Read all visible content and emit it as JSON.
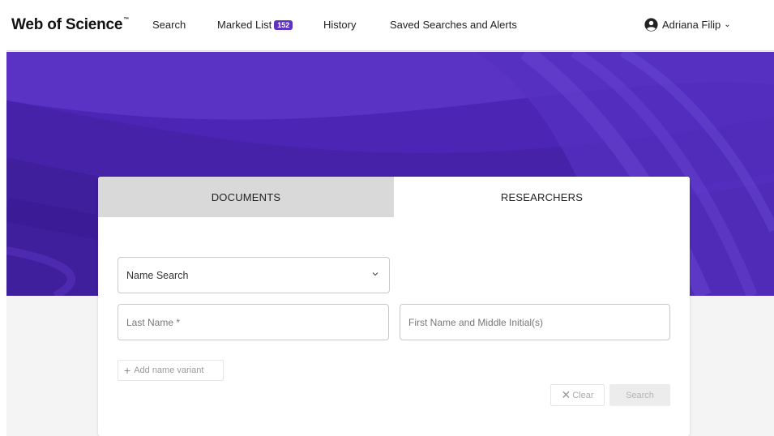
{
  "brand": {
    "name": "Web of Science",
    "mark": "™"
  },
  "nav": {
    "search": "Search",
    "marked_list": "Marked List",
    "marked_count": "152",
    "history": "History",
    "saved": "Saved Searches and Alerts"
  },
  "user": {
    "name": "Adriana Filip",
    "icon": "user-circle-icon"
  },
  "tabs": {
    "documents": "DOCUMENTS",
    "researchers": "RESEARCHERS"
  },
  "form": {
    "search_type": "Name Search",
    "last_name_placeholder": "Last Name *",
    "first_name_placeholder": "First Name and Middle Initial(s)",
    "add_variant": "Add name variant",
    "clear": "Clear",
    "search": "Search"
  },
  "colors": {
    "brand_purple": "#5e33bf",
    "hero": "#4f27b8",
    "tab_inactive": "#d9d9d9"
  }
}
